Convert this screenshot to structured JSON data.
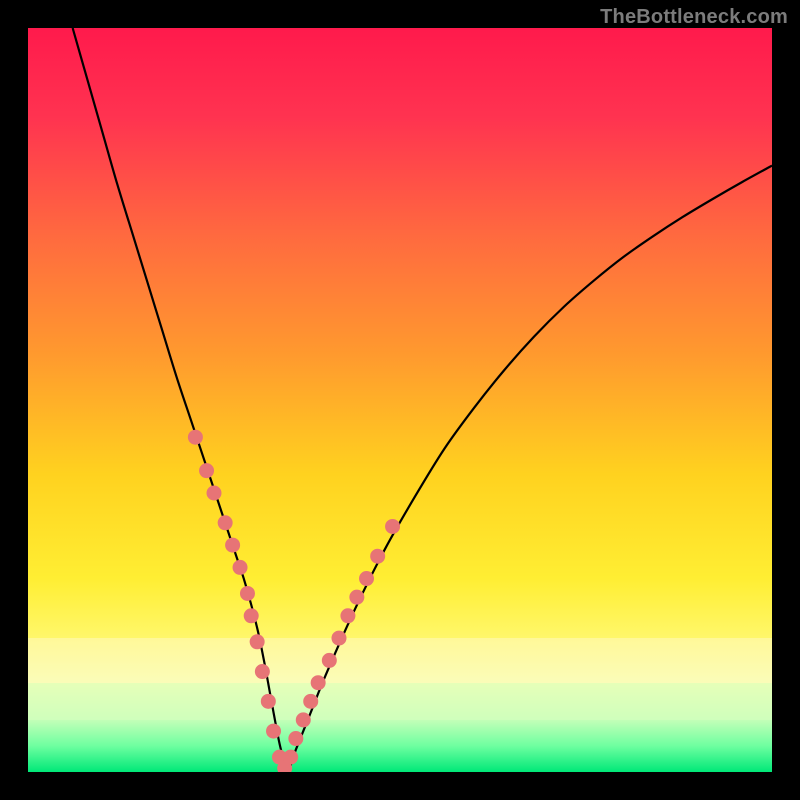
{
  "watermark": "TheBottleneck.com",
  "chart_data": {
    "type": "line",
    "title": "",
    "xlabel": "",
    "ylabel": "",
    "xlim": [
      0,
      100
    ],
    "ylim": [
      0,
      100
    ],
    "series": [
      {
        "name": "bottleneck-curve",
        "x": [
          6,
          8,
          10,
          12,
          14,
          16,
          18,
          20,
          22,
          24,
          26,
          28,
          29,
          30,
          31,
          32,
          33,
          34,
          35,
          36,
          38,
          40,
          44,
          48,
          52,
          56,
          60,
          64,
          68,
          72,
          76,
          80,
          84,
          88,
          92,
          96,
          100
        ],
        "y": [
          100,
          93,
          86,
          79,
          72.5,
          66,
          59.5,
          53,
          47,
          41,
          35,
          29,
          26,
          22.5,
          18.5,
          13.5,
          8,
          3,
          0.5,
          3,
          8,
          13,
          22,
          30,
          37,
          43.5,
          49,
          54,
          58.5,
          62.5,
          66,
          69.2,
          72,
          74.6,
          77,
          79.3,
          81.5
        ]
      }
    ],
    "markers": {
      "name": "highlight-dots",
      "color": "#e77476",
      "points": [
        {
          "x": 22.5,
          "y": 45
        },
        {
          "x": 24,
          "y": 40.5
        },
        {
          "x": 25,
          "y": 37.5
        },
        {
          "x": 26.5,
          "y": 33.5
        },
        {
          "x": 27.5,
          "y": 30.5
        },
        {
          "x": 28.5,
          "y": 27.5
        },
        {
          "x": 29.5,
          "y": 24
        },
        {
          "x": 30,
          "y": 21
        },
        {
          "x": 30.8,
          "y": 17.5
        },
        {
          "x": 31.5,
          "y": 13.5
        },
        {
          "x": 32.3,
          "y": 9.5
        },
        {
          "x": 33,
          "y": 5.5
        },
        {
          "x": 33.8,
          "y": 2
        },
        {
          "x": 34.5,
          "y": 0.5
        },
        {
          "x": 35.3,
          "y": 2
        },
        {
          "x": 36,
          "y": 4.5
        },
        {
          "x": 37,
          "y": 7
        },
        {
          "x": 38,
          "y": 9.5
        },
        {
          "x": 39,
          "y": 12
        },
        {
          "x": 40.5,
          "y": 15
        },
        {
          "x": 41.8,
          "y": 18
        },
        {
          "x": 43,
          "y": 21
        },
        {
          "x": 44.2,
          "y": 23.5
        },
        {
          "x": 45.5,
          "y": 26
        },
        {
          "x": 47,
          "y": 29
        },
        {
          "x": 49,
          "y": 33
        }
      ]
    },
    "gradient_stops": [
      {
        "offset": 0,
        "color": "#ff1a4c"
      },
      {
        "offset": 0.12,
        "color": "#ff3350"
      },
      {
        "offset": 0.28,
        "color": "#ff6a3f"
      },
      {
        "offset": 0.44,
        "color": "#ff9a2e"
      },
      {
        "offset": 0.6,
        "color": "#ffd21f"
      },
      {
        "offset": 0.74,
        "color": "#ffee33"
      },
      {
        "offset": 0.82,
        "color": "#fff76a"
      },
      {
        "offset": 0.88,
        "color": "#f6ffb0"
      },
      {
        "offset": 0.93,
        "color": "#c3ffb8"
      },
      {
        "offset": 0.965,
        "color": "#6effa0"
      },
      {
        "offset": 1.0,
        "color": "#00e878"
      }
    ],
    "sweet_spot_bands": [
      {
        "y_from": 82,
        "y_to": 88,
        "color": "#fff9c0",
        "opacity": 0.55
      },
      {
        "y_from": 88,
        "y_to": 93,
        "color": "#d8ffc0",
        "opacity": 0.55
      }
    ]
  }
}
